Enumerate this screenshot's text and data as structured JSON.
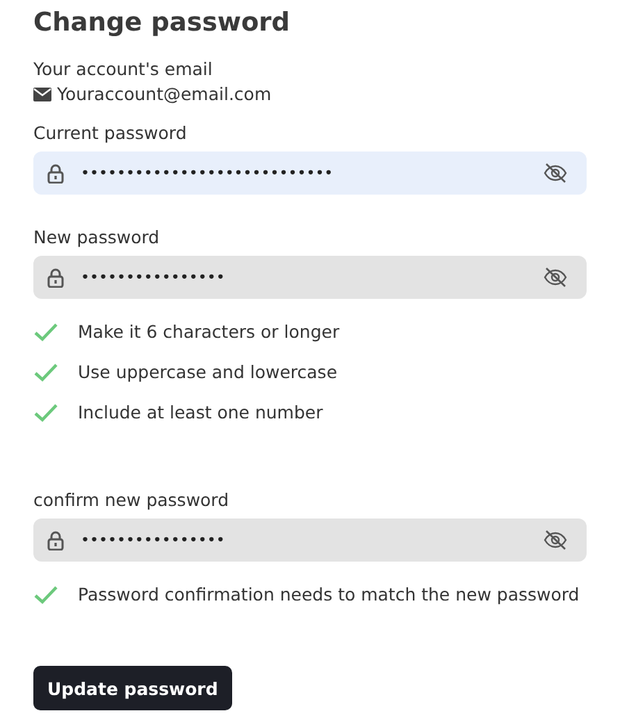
{
  "title": "Change password",
  "email": {
    "label": "Your account's email",
    "value": "Youraccount@email.com"
  },
  "current": {
    "label": "Current password",
    "value": "••••••••••••••••••••••••••••",
    "focused": true
  },
  "new": {
    "label": "New password",
    "value": "••••••••••••••••",
    "focused": false
  },
  "rules": [
    {
      "text": "Make it 6 characters or longer",
      "met": true
    },
    {
      "text": "Use uppercase and lowercase",
      "met": true
    },
    {
      "text": "Include at least one number",
      "met": true
    }
  ],
  "confirm": {
    "label": "confirm new password",
    "value": "••••••••••••••••",
    "focused": false
  },
  "confirm_rules": [
    {
      "text": "Password confirmation needs to match the new password",
      "met": true
    }
  ],
  "button": "Update password"
}
